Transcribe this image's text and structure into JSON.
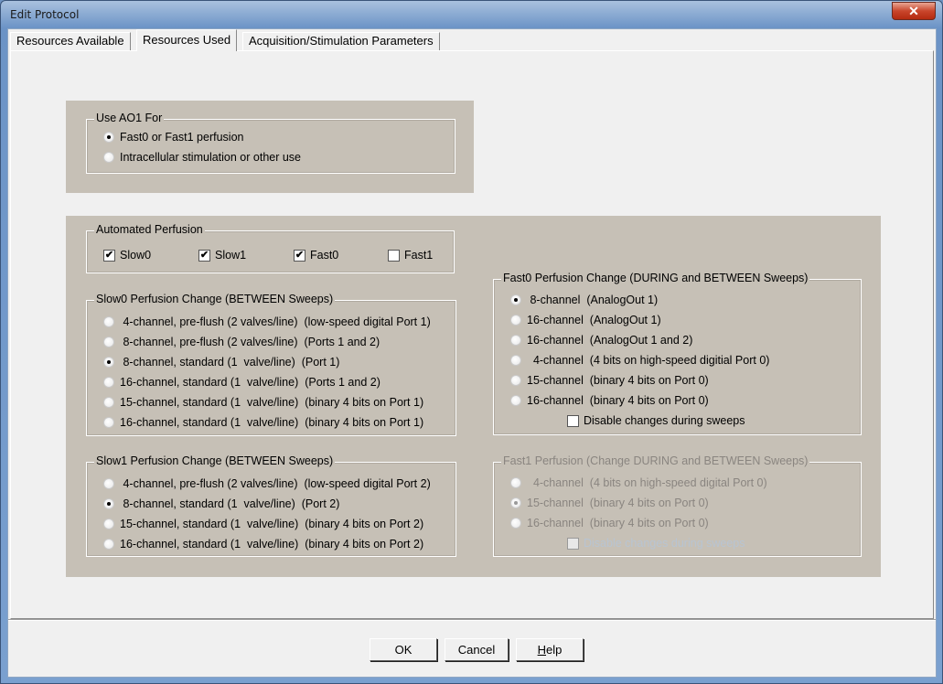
{
  "window": {
    "title": "Edit Protocol",
    "close": "✕"
  },
  "tabs": [
    {
      "label": "Resources Available"
    },
    {
      "label": "Resources Used"
    },
    {
      "label": "Acquisition/Stimulation Parameters"
    }
  ],
  "ao1": {
    "title": "Use AO1 For",
    "options": [
      {
        "label": "Fast0 or Fast1 perfusion",
        "selected": true
      },
      {
        "label": "Intracellular stimulation or other use",
        "selected": false
      }
    ]
  },
  "automated": {
    "title": "Automated Perfusion",
    "checks": [
      {
        "label": "Slow0",
        "checked": true
      },
      {
        "label": "Slow1",
        "checked": true
      },
      {
        "label": "Fast0",
        "checked": true
      },
      {
        "label": "Fast1",
        "checked": false
      }
    ]
  },
  "slow0": {
    "title": "Slow0 Perfusion Change (BETWEEN Sweeps)",
    "options": [
      {
        "label": " 4-channel, pre-flush (2 valves/line)  (low-speed digital Port 1)",
        "selected": false
      },
      {
        "label": " 8-channel, pre-flush (2 valves/line)  (Ports 1 and 2)",
        "selected": false
      },
      {
        "label": " 8-channel, standard (1  valve/line)  (Port 1)",
        "selected": true
      },
      {
        "label": "16-channel, standard (1  valve/line)  (Ports 1 and 2)",
        "selected": false
      },
      {
        "label": "15-channel, standard (1  valve/line)  (binary 4 bits on Port 1)",
        "selected": false
      },
      {
        "label": "16-channel, standard (1  valve/line)  (binary 4 bits on Port 1)",
        "selected": false
      }
    ]
  },
  "slow1": {
    "title": "Slow1 Perfusion Change (BETWEEN Sweeps)",
    "options": [
      {
        "label": " 4-channel, pre-flush (2 valves/line)  (low-speed digital Port 2)",
        "selected": false
      },
      {
        "label": " 8-channel, standard (1  valve/line)  (Port 2)",
        "selected": true
      },
      {
        "label": "15-channel, standard (1  valve/line)  (binary 4 bits on Port 2)",
        "selected": false
      },
      {
        "label": "16-channel, standard (1  valve/line)  (binary 4 bits on Port 2)",
        "selected": false
      }
    ]
  },
  "fast0": {
    "title": "Fast0 Perfusion Change (DURING and BETWEEN Sweeps)",
    "options": [
      {
        "label": " 8-channel  (AnalogOut 1)",
        "selected": true
      },
      {
        "label": "16-channel  (AnalogOut 1)",
        "selected": false
      },
      {
        "label": "16-channel  (AnalogOut 1 and 2)",
        "selected": false
      },
      {
        "label": "  4-channel  (4 bits on high-speed digitial Port 0)",
        "selected": false
      },
      {
        "label": "15-channel  (binary 4 bits on Port 0)",
        "selected": false
      },
      {
        "label": "16-channel  (binary 4 bits on Port 0)",
        "selected": false
      }
    ],
    "disable": {
      "label": "Disable changes during sweeps",
      "checked": false
    }
  },
  "fast1": {
    "title": "Fast1 Perfusion (Change DURING and BETWEEN Sweeps)",
    "options": [
      {
        "label": "  4-channel  (4 bits on high-speed digital Port 0)",
        "selected": false
      },
      {
        "label": "15-channel  (binary 4 bits on Port 0)",
        "selected": true
      },
      {
        "label": "16-channel  (binary 4 bits on Port 0)",
        "selected": false
      }
    ],
    "disable": {
      "label": "Disable changes during sweeps",
      "checked": false
    }
  },
  "buttons": {
    "ok": "OK",
    "cancel": "Cancel",
    "help_prefix": "H",
    "help_rest": "elp"
  }
}
